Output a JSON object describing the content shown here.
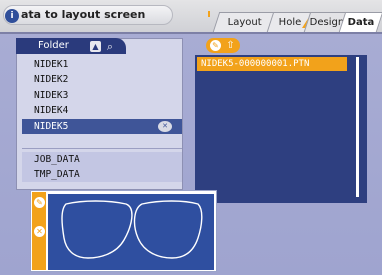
{
  "header": {
    "back_label": "ata to layout screen",
    "back_icon": "back-icon",
    "tabs": [
      {
        "label": "Layout"
      },
      {
        "label": "Hole"
      },
      {
        "label": "Design"
      },
      {
        "label": "Data"
      }
    ]
  },
  "folder_panel": {
    "title": "Folder",
    "items": [
      "NIDEK1",
      "NIDEK2",
      "NIDEK3",
      "NIDEK4",
      "NIDEK5"
    ],
    "selected": "NIDEK5",
    "groups": [
      "JOB_DATA",
      "TMP_DATA"
    ]
  },
  "files_panel": {
    "selected_file": "NIDEK5-000000001.PTN"
  },
  "colors": {
    "accent_orange": "#f2a21b",
    "panel_blue": "#2e3f80",
    "selected_row": "#3f5598",
    "background": "#a9add4"
  }
}
